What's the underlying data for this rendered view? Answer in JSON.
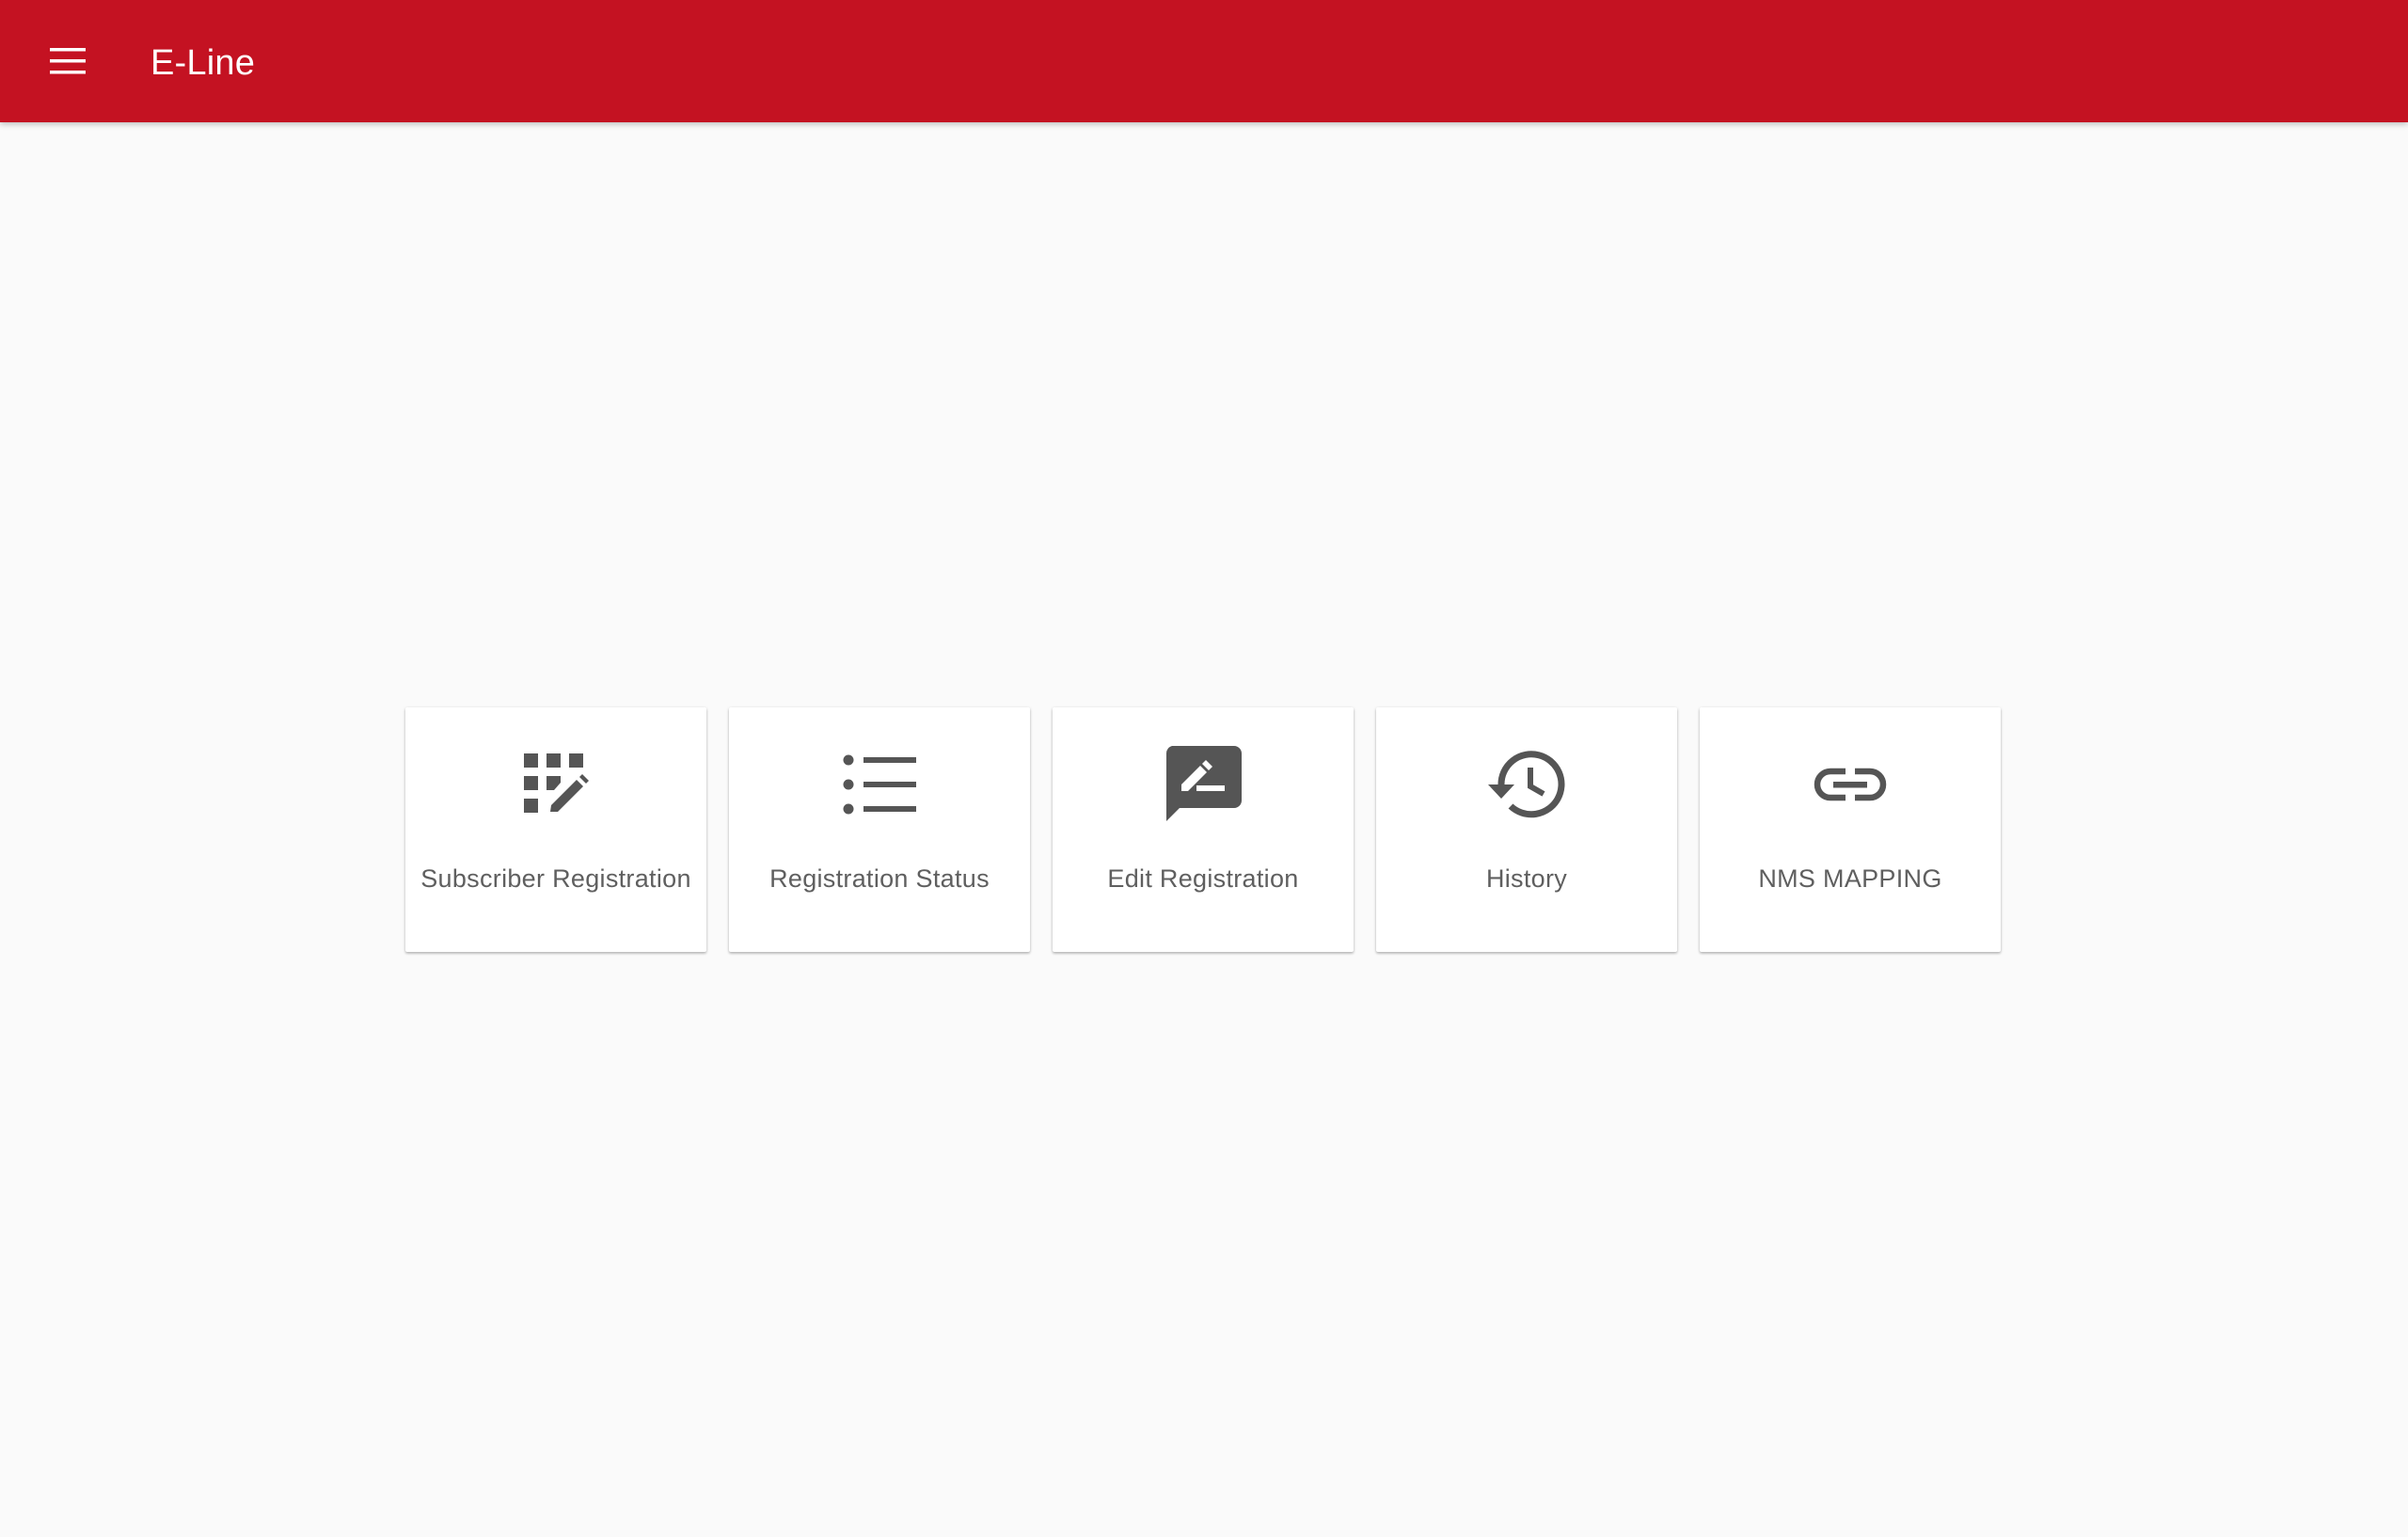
{
  "app_bar": {
    "title": "E-Line",
    "menu_icon": "menu-icon",
    "color": "#c41222"
  },
  "tiles": [
    {
      "icon": "dialpad-edit-icon",
      "label": "Subscriber Registration"
    },
    {
      "icon": "list-icon",
      "label": "Registration Status"
    },
    {
      "icon": "rate-review-icon",
      "label": "Edit Registration"
    },
    {
      "icon": "history-icon",
      "label": "History"
    },
    {
      "icon": "link-icon",
      "label": "NMS MAPPING"
    }
  ],
  "colors": {
    "background": "#fafafa",
    "tile_background": "#ffffff",
    "icon": "#555555",
    "label": "#5f5f5f"
  }
}
